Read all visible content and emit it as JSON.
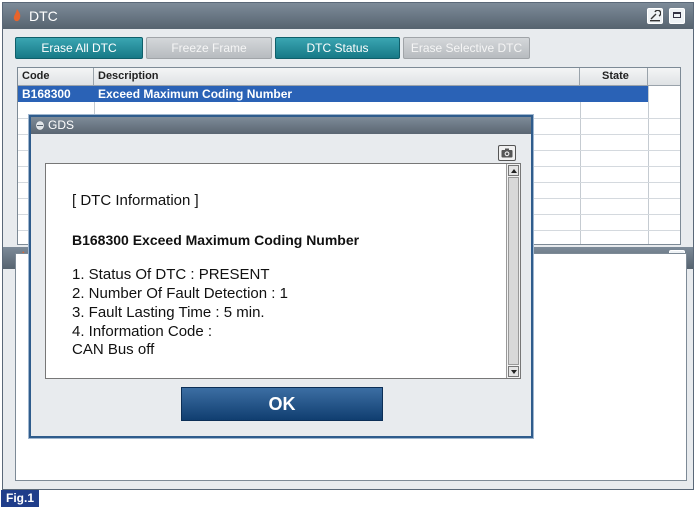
{
  "main_window": {
    "title": "DTC"
  },
  "toolbar": {
    "buttons": [
      {
        "label": "Erase All DTC",
        "state": "active"
      },
      {
        "label": "Freeze Frame",
        "state": "inactive"
      },
      {
        "label": "DTC Status",
        "state": "active"
      },
      {
        "label": "Erase Selective DTC",
        "state": "inactive"
      }
    ]
  },
  "dtc_table": {
    "columns": [
      "Code",
      "Description",
      "State"
    ],
    "rows": [
      {
        "code": "B168300",
        "description": "Exceed Maximum Coding Number",
        "state": "",
        "selected": true
      }
    ]
  },
  "gds_dialog": {
    "title": "GDS",
    "heading": "[ DTC Information ]",
    "dtc_line": "B168300  Exceed Maximum Coding Number",
    "lines": [
      "1. Status Of DTC : PRESENT",
      "2. Number Of Fault Detection : 1",
      "3. Fault Lasting Time : 5 min.",
      "4. Information Code :",
      "CAN Bus off"
    ],
    "ok_label": "OK"
  },
  "figure_label": "Fig.1",
  "colors": {
    "active_button": "#1f8d9a",
    "selected_row": "#2a62b6",
    "ok_button": "#1d4d82",
    "titlebar": "#66737f"
  },
  "icons": [
    "flame-icon",
    "setup-icon",
    "maximize-icon",
    "camera-icon"
  ]
}
